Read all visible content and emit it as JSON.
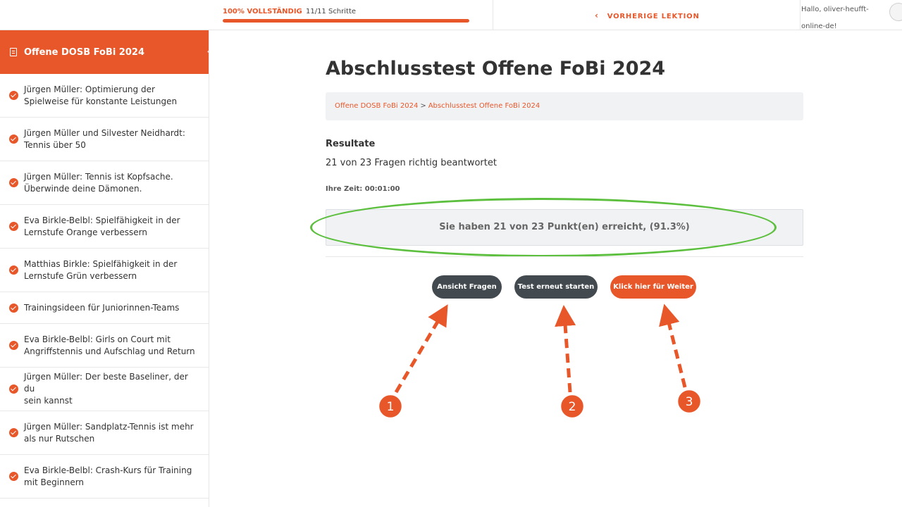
{
  "topbar": {
    "progress_pct_label": "100% VOLLSTÄNDIG",
    "progress_steps": "11/11 Schritte",
    "progress_value": 1.0,
    "prev_lesson_label": "VORHERIGE LEKTION",
    "greeting_line1": "Hallo, oliver-heufft-",
    "greeting_line2": "online-de!"
  },
  "sidebar": {
    "course_title": "Offene DOSB FoBi 2024",
    "lessons": [
      {
        "line1": "Jürgen Müller: Optimierung der",
        "line2": "Spielweise für konstante Leistungen"
      },
      {
        "line1": "Jürgen Müller und Silvester Neidhardt:",
        "line2": "Tennis über 50"
      },
      {
        "line1": "Jürgen Müller: Tennis ist Kopfsache.",
        "line2": "Überwinde deine Dämonen."
      },
      {
        "line1": "Eva Birkle-Belbl: Spielfähigkeit in der",
        "line2": "Lernstufe Orange verbessern"
      },
      {
        "line1": "Matthias Birkle: Spielfähigkeit in der",
        "line2": "Lernstufe Grün verbessern"
      },
      {
        "line1": "Trainingsideen für Juniorinnen-Teams",
        "line2": ""
      },
      {
        "line1": "Eva Birkle-Belbl: Girls on Court mit",
        "line2": "Angriffstennis und Aufschlag und Return"
      },
      {
        "line1": "Jürgen Müller: Der beste Baseliner, der du",
        "line2": "sein kannst"
      },
      {
        "line1": "Jürgen Müller: Sandplatz-Tennis ist mehr",
        "line2": "als nur Rutschen"
      },
      {
        "line1": "Eva Birkle-Belbl: Crash-Kurs für Training",
        "line2": "mit Beginnern"
      }
    ]
  },
  "main": {
    "title": "Abschlusstest Offene FoBi 2024",
    "breadcrumb": [
      "Offene DOSB FoBi 2024",
      "Abschlusstest Offene FoBi 2024"
    ],
    "breadcrumb_sep": ">",
    "results_heading": "Resultate",
    "results_text": "21 von 23 Fragen richtig beantwortet",
    "time_text": "Ihre Zeit: 00:01:00",
    "score_text": "Sie haben 21 von 23 Punkt(en) erreicht, (91.3%)",
    "buttons": {
      "view_questions": "Ansicht Fragen",
      "restart": "Test erneut starten",
      "continue": "Klick hier für Weiter"
    }
  },
  "annotations": {
    "markers": [
      "1",
      "2",
      "3"
    ]
  },
  "colors": {
    "accent": "#e8572a",
    "dark_button": "#434a4f",
    "highlight": "#5cbf3e",
    "panel": "#f1f2f4"
  }
}
